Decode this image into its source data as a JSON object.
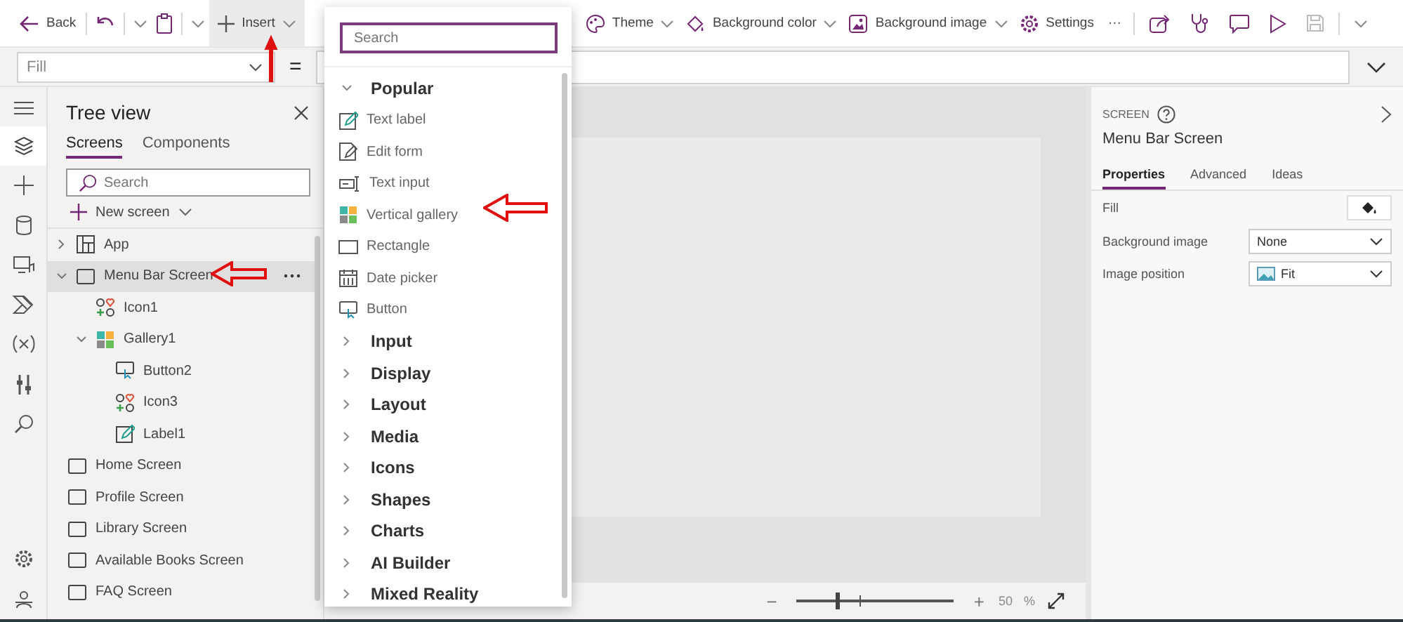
{
  "toolbar": {
    "back": "Back",
    "insert": "Insert",
    "items": [
      {
        "kind": "theme",
        "label": "Theme"
      },
      {
        "kind": "color",
        "label": "Background color"
      },
      {
        "kind": "image",
        "label": "Background image"
      },
      {
        "kind": "settings",
        "label": "Settings"
      }
    ],
    "more": "···"
  },
  "formula_bar": {
    "property": "Fill",
    "equals": "="
  },
  "rail": [
    {
      "kind": "layers",
      "selected": true
    },
    {
      "kind": "plus",
      "selected": false
    },
    {
      "kind": "data",
      "selected": false
    },
    {
      "kind": "media",
      "selected": false
    },
    {
      "kind": "power",
      "selected": false
    },
    {
      "kind": "variables",
      "selected": false
    },
    {
      "kind": "tools",
      "selected": false
    },
    {
      "kind": "search",
      "selected": false
    }
  ],
  "tree": {
    "title": "Tree view",
    "tabs": [
      {
        "label": "Screens",
        "selected": true
      },
      {
        "label": "Components",
        "selected": false
      }
    ],
    "search": {
      "placeholder": "Search"
    },
    "new_screen": "New screen",
    "items": [
      {
        "label": "App",
        "kind": "app",
        "expanded": false,
        "selected": false
      },
      {
        "label": "Menu Bar Screen",
        "kind": "screen",
        "expanded": true,
        "selected": true,
        "children": [
          {
            "label": "Icon1",
            "kind": "icon",
            "selected": false
          },
          {
            "label": "Gallery1",
            "kind": "gallery",
            "expanded": true,
            "selected": false,
            "children": [
              {
                "label": "Button2",
                "kind": "button",
                "selected": false
              },
              {
                "label": "Icon3",
                "kind": "icon",
                "selected": false
              },
              {
                "label": "Label1",
                "kind": "label",
                "selected": false
              }
            ]
          }
        ]
      },
      {
        "label": "Home Screen",
        "kind": "screen",
        "selected": false
      },
      {
        "label": "Profile Screen",
        "kind": "screen",
        "selected": false
      },
      {
        "label": "Library Screen",
        "kind": "screen",
        "selected": false
      },
      {
        "label": "Available Books Screen",
        "kind": "screen",
        "selected": false
      },
      {
        "label": "FAQ Screen",
        "kind": "screen",
        "selected": false
      }
    ]
  },
  "insert_menu": {
    "search": {
      "placeholder": "Search"
    },
    "popular": {
      "label": "Popular",
      "expanded": true,
      "items": [
        {
          "label": "Text label",
          "kind": "label"
        },
        {
          "label": "Edit form",
          "kind": "form"
        },
        {
          "label": "Text input",
          "kind": "input"
        },
        {
          "label": "Vertical gallery",
          "kind": "gallery"
        },
        {
          "label": "Rectangle",
          "kind": "rectangle"
        },
        {
          "label": "Date picker",
          "kind": "date"
        },
        {
          "label": "Button",
          "kind": "button"
        }
      ]
    },
    "categories": [
      {
        "label": "Input",
        "expanded": false
      },
      {
        "label": "Display",
        "expanded": false
      },
      {
        "label": "Layout",
        "expanded": false
      },
      {
        "label": "Media",
        "expanded": false
      },
      {
        "label": "Icons",
        "expanded": false
      },
      {
        "label": "Shapes",
        "expanded": false
      },
      {
        "label": "Charts",
        "expanded": false
      },
      {
        "label": "AI Builder",
        "expanded": false
      },
      {
        "label": "Mixed Reality",
        "expanded": false
      }
    ]
  },
  "zoom": {
    "minus": "−",
    "plus": "+",
    "value": "50",
    "unit": "%",
    "level": 0.25
  },
  "properties": {
    "type": "SCREEN",
    "name": "Menu Bar Screen",
    "tabs": [
      {
        "label": "Properties",
        "selected": true
      },
      {
        "label": "Advanced",
        "selected": false
      },
      {
        "label": "Ideas",
        "selected": false
      }
    ],
    "rows": [
      {
        "label": "Fill",
        "kind": "color"
      },
      {
        "label": "Background image",
        "kind": "dropdown",
        "value": "None"
      },
      {
        "label": "Image position",
        "kind": "image-dropdown",
        "value": "Fit"
      }
    ]
  }
}
